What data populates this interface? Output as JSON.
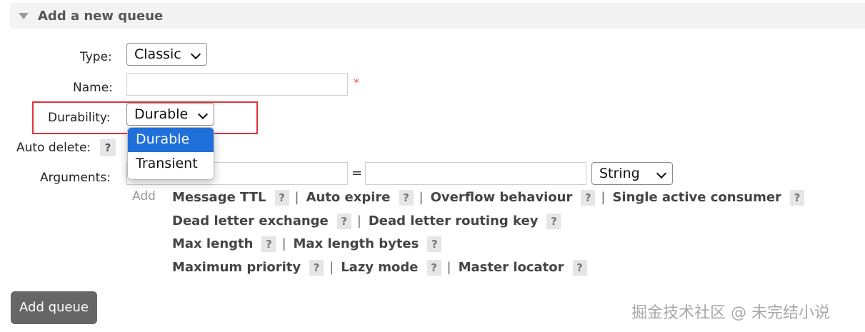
{
  "section": {
    "title": "Add a new queue"
  },
  "form": {
    "type_label": "Type:",
    "type_value": "Classic",
    "name_label": "Name:",
    "name_value": "",
    "required_mark": "*",
    "durability_label": "Durability:",
    "durability_value": "Durable",
    "auto_delete_label": "Auto delete:",
    "help_mark": "?",
    "arguments_label": "Arguments:",
    "equals": "=",
    "arg_type_value": "String",
    "add_link": "Add"
  },
  "dropdown": {
    "options": [
      "Durable",
      "Transient"
    ],
    "selected": "Durable"
  },
  "argument_shortcuts": [
    [
      "Message TTL",
      "Auto expire",
      "Overflow behaviour",
      "Single active consumer"
    ],
    [
      "Dead letter exchange",
      "Dead letter routing key"
    ],
    [
      "Max length",
      "Max length bytes"
    ],
    [
      "Maximum priority",
      "Lazy mode",
      "Master locator"
    ]
  ],
  "separator": "|",
  "submit_label": "Add queue",
  "watermark": "掘金技术社区 @ 未完结小说"
}
